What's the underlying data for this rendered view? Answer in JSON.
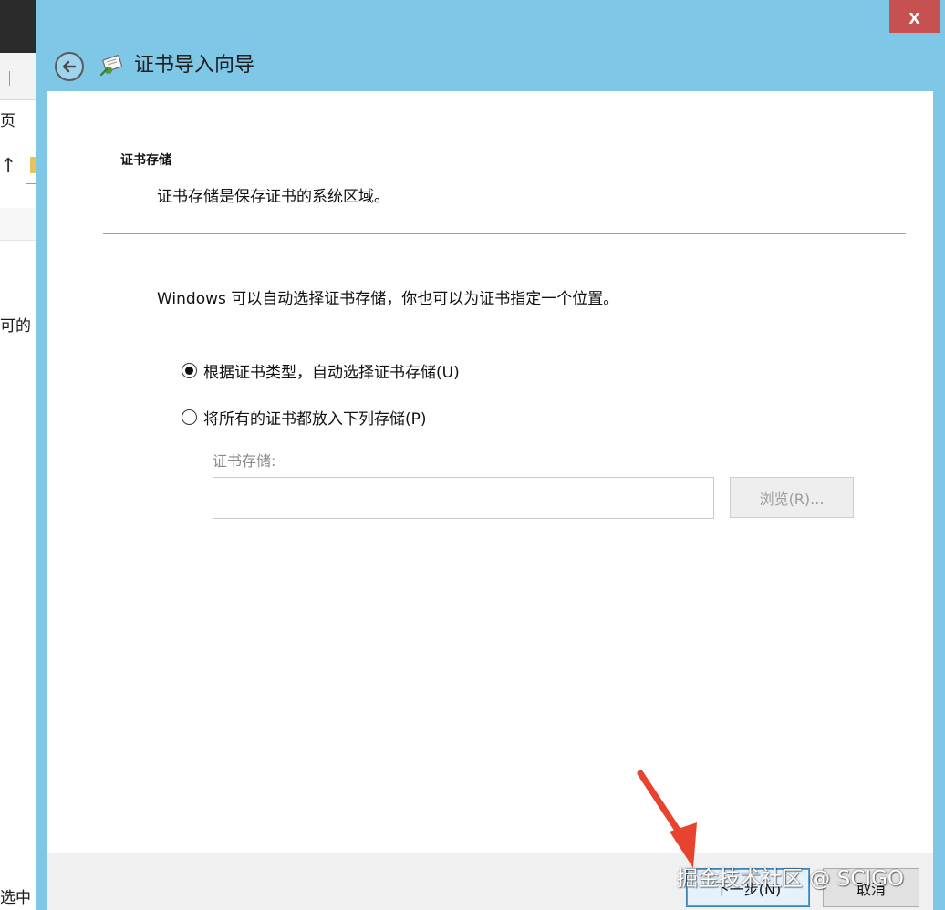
{
  "background_window": {
    "fragments": {
      "ribbon_text": "页",
      "side_text": "可的",
      "bottom_text": "选中"
    }
  },
  "dialog": {
    "title": "证书导入向导",
    "close_label": "x",
    "section_title": "证书存储",
    "section_desc": "证书存储是保存证书的系统区域。",
    "intro_text": "Windows 可以自动选择证书存储，你也可以为证书指定一个位置。",
    "options": [
      {
        "label": "根据证书类型，自动选择证书存储(U)",
        "selected": true
      },
      {
        "label": "将所有的证书都放入下列存储(P)",
        "selected": false
      }
    ],
    "store_label": "证书存储:",
    "store_value": "",
    "browse_label": "浏览(R)...",
    "next_label": "下一步(N)",
    "cancel_label": "取消"
  },
  "overlay": {
    "watermark": "掘金技术社区 @ SCIGO",
    "arrow_color": "#e8432e"
  },
  "colors": {
    "frame": "#7ec7e6",
    "close": "#c75050",
    "next_border": "#3c7fb1"
  },
  "icons": {
    "back": "back-arrow-icon",
    "wizard": "certificate-wizard-icon",
    "radio_selected": "radio-selected-icon",
    "radio_empty": "radio-empty-icon"
  }
}
